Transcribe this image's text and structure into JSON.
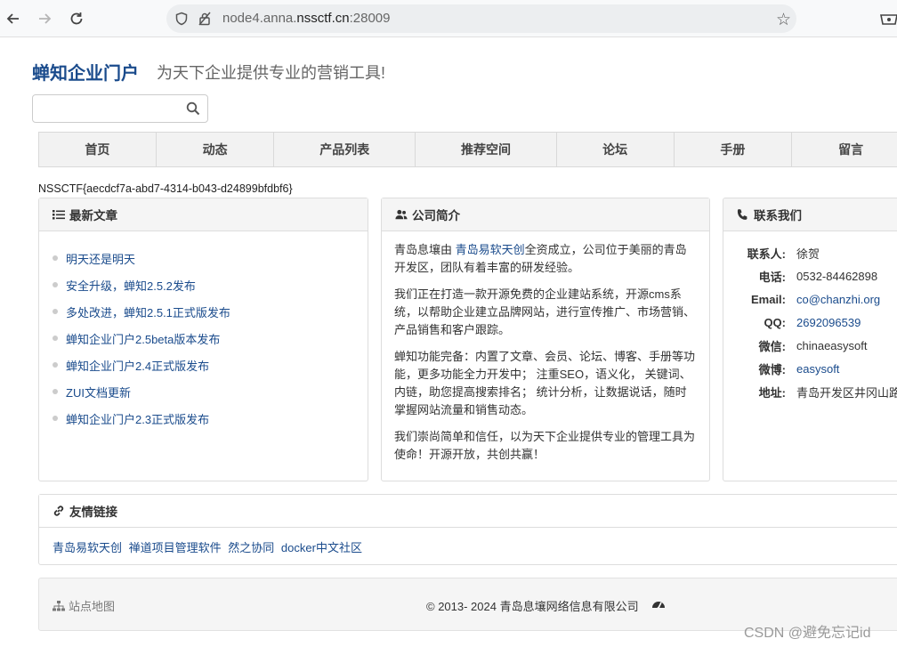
{
  "browser": {
    "url_prefix": "node4.anna.",
    "url_domain": "nssctf.cn",
    "url_port": ":28009"
  },
  "site": {
    "brand": "蝉知企业门户",
    "slogan": "为天下企业提供专业的营销工具!",
    "search_placeholder": ""
  },
  "nav": [
    "首页",
    "动态",
    "产品列表",
    "推荐空间",
    "论坛",
    "手册",
    "留言"
  ],
  "flag": "NSSCTF{aecdcf7a-abd7-4314-b043-d24899bfdbf6}",
  "latest": {
    "title": "最新文章",
    "items": [
      "明天还是明天",
      "安全升级，蝉知2.5.2发布",
      "多处改进，蝉知2.5.1正式版发布",
      "蝉知企业门户2.5beta版本发布",
      "蝉知企业门户2.4正式版发布",
      "ZUI文档更新",
      "蝉知企业门户2.3正式版发布"
    ]
  },
  "about": {
    "title": "公司简介",
    "p1_before": "青岛息壤由 ",
    "p1_link": "青岛易软天创",
    "p1_after": "全资成立，公司位于美丽的青岛开发区，团队有着丰富的研发经验。",
    "p2": "我们正在打造一款开源免费的企业建站系统，开源cms系统，以帮助企业建立品牌网站，进行宣传推广、市场营销、产品销售和客户跟踪。",
    "p3": "蝉知功能完备：内置了文章、会员、论坛、博客、手册等功能，更多功能全力开发中； 注重SEO，语义化， 关键词、内链，助您提高搜索排名； 统计分析，让数据说话，随时掌握网站流量和销售动态。",
    "p4": "我们崇尚简单和信任，以为天下企业提供专业的管理工具为使命！开源开放，共创共赢！"
  },
  "contact": {
    "title": "联系我们",
    "rows": [
      {
        "label": "联系人:",
        "value": "徐贺"
      },
      {
        "label": "电话:",
        "value": "0532-84462898"
      },
      {
        "label": "Email:",
        "value": "co@chanzhi.org"
      },
      {
        "label": "QQ:",
        "value": "2692096539"
      },
      {
        "label": "微信:",
        "value": "chinaeasysoft"
      },
      {
        "label": "微博:",
        "value": "easysoft"
      },
      {
        "label": "地址:",
        "value": "青岛开发区井冈山路"
      }
    ]
  },
  "links": {
    "title": "友情链接",
    "items": [
      "青岛易软天创",
      "禅道项目管理软件",
      "然之协同",
      "docker中文社区"
    ]
  },
  "footer": {
    "sitemap": "站点地图",
    "copyright": "© 2013- 2024 青岛息壤网络信息有限公司"
  },
  "watermark": "CSDN @避免忘记id"
}
